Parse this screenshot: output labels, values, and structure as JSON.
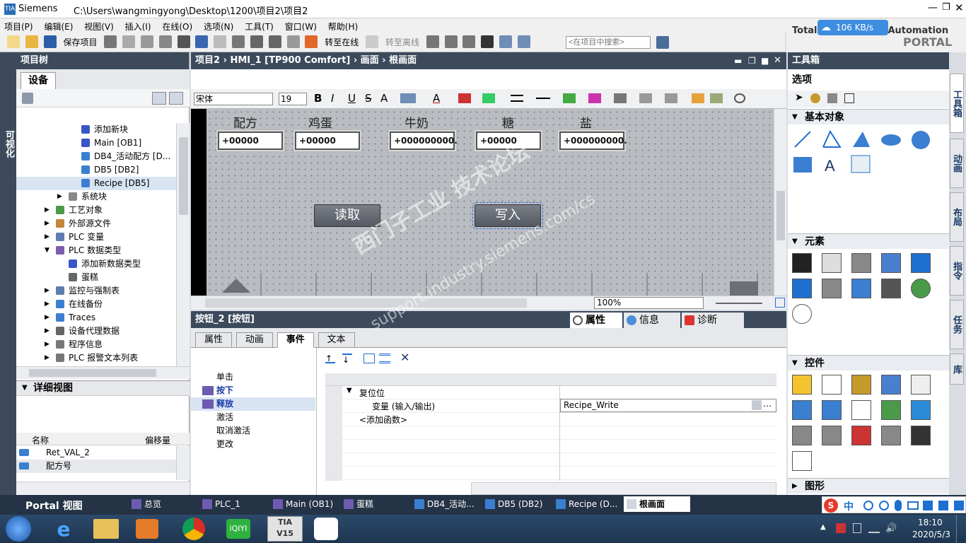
{
  "title": {
    "app": "Siemens",
    "path": "C:\\Users\\wangmingyong\\Desktop\\1200\\项目2\\项目2"
  },
  "brand": {
    "line1": "Totally Integrated Automation",
    "line2": "PORTAL",
    "speed": "106 KB/s"
  },
  "menu": [
    "项目(P)",
    "编辑(E)",
    "视图(V)",
    "插入(I)",
    "在线(O)",
    "选项(N)",
    "工具(T)",
    "窗口(W)",
    "帮助(H)"
  ],
  "toolbar": {
    "save": "保存项目",
    "go_online": "转至在线",
    "go_offline": "转至离线",
    "search_placeholder": "<在项目中搜索>"
  },
  "left_strip": "可视化",
  "project_tree": {
    "title": "项目树",
    "tab": "设备",
    "items": [
      {
        "label": "添加新块",
        "indent": 2
      },
      {
        "label": "Main [OB1]",
        "indent": 2
      },
      {
        "label": "DB4_活动配方 [D...",
        "indent": 2
      },
      {
        "label": "DB5 [DB2]",
        "indent": 2
      },
      {
        "label": "Recipe [DB5]",
        "indent": 2
      },
      {
        "label": "系统块",
        "indent": 1
      },
      {
        "label": "工艺对象",
        "indent": 0
      },
      {
        "label": "外部源文件",
        "indent": 0
      },
      {
        "label": "PLC 变量",
        "indent": 0
      },
      {
        "label": "PLC 数据类型",
        "indent": 0
      },
      {
        "label": "添加新数据类型",
        "indent": 1
      },
      {
        "label": "蛋糕",
        "indent": 1
      },
      {
        "label": "监控与强制表",
        "indent": 0
      },
      {
        "label": "在线备份",
        "indent": 0
      },
      {
        "label": "Traces",
        "indent": 0
      },
      {
        "label": "设备代理数据",
        "indent": 0
      },
      {
        "label": "程序信息",
        "indent": 0
      },
      {
        "label": "PLC 报警文本列表",
        "indent": 0
      }
    ]
  },
  "detail_view": {
    "title": "详细视图",
    "col_name": "名称",
    "col_offset": "偏移量",
    "rows": [
      "Ret_VAL_2",
      "配方号"
    ]
  },
  "editor": {
    "breadcrumb": "项目2 › HMI_1 [TP900 Comfort] › 画面 › 根画面",
    "font": "宋体",
    "font_size": "19",
    "zoom": "100%",
    "labels": [
      "配方",
      "鸡蛋",
      "牛奶",
      "糖",
      "盐"
    ],
    "fields": [
      "+00000",
      "+00000",
      "+000000000.",
      "+00000",
      "+000000000."
    ],
    "btn_read": "读取",
    "btn_write": "写入"
  },
  "inspector": {
    "title": "按钮_2 [按钮]",
    "top_tabs": [
      "属性",
      "信息",
      "诊断"
    ],
    "tabs": [
      "属性",
      "动画",
      "事件",
      "文本"
    ],
    "events": [
      "单击",
      "按下",
      "释放",
      "激活",
      "取消激活",
      "更改"
    ],
    "func_name": "复位位",
    "param_label": "变量 (输入/输出)",
    "param_value": "Recipe_Write",
    "add_func": "<添加函数>"
  },
  "toolbox": {
    "title": "工具箱",
    "options": "选项",
    "sections": [
      "基本对象",
      "元素",
      "控件",
      "图形"
    ],
    "side_tabs": [
      "工具箱",
      "动画",
      "布局",
      "指令",
      "任务",
      "库"
    ]
  },
  "portal_bar": {
    "portal_view": "Portal 视图",
    "tasks": [
      "总览",
      "PLC_1",
      "Main (OB1)",
      "蛋糕",
      "DB4_活动...",
      "DB5 (DB2)",
      "Recipe (D...",
      "根画面"
    ]
  },
  "taskbar": {
    "time": "18:10",
    "date": "2020/5/3",
    "ime": "中"
  },
  "watermark": {
    "line1": "西门子工业 技术论坛",
    "line2": "support.industry.siemens.com/cs"
  },
  "colors": {
    "panel_header": "#3c4a5c",
    "accent": "#1f6fd1",
    "taskbar": "#1d3550"
  }
}
